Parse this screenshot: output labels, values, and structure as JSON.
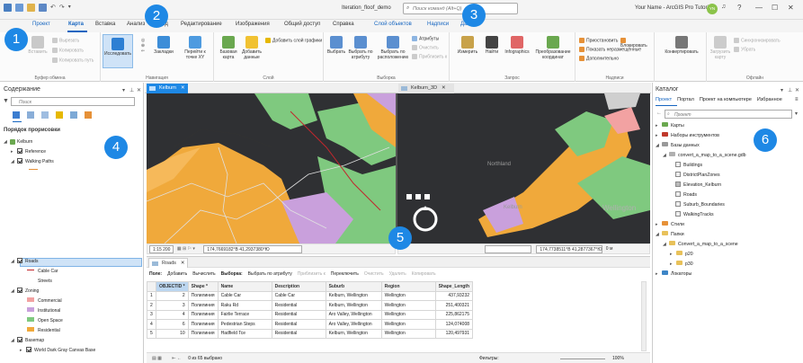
{
  "titlebar": {
    "doc_title": "Iteration_floof_demo",
    "search_placeholder": "Поиск команд (Alt+Q)",
    "user": "Your Name - ArcGIS Pro Tutorials",
    "avatar": "YN",
    "controls": [
      "?",
      "—",
      "☐",
      "✕"
    ]
  },
  "tabs": [
    "Проект",
    "Карта",
    "Вставка",
    "Анализ",
    "Вид",
    "Редактирование",
    "Изображения",
    "Общий доступ",
    "Справка",
    "Слой объектов",
    "Надписи",
    "Данные"
  ],
  "active_tab": "Карта",
  "ribbon": {
    "clipboard": {
      "paste": "Вставить",
      "cut": "Вырезать",
      "copy": "Копировать",
      "copy_path": "Копировать путь",
      "label": "Буфер обмена"
    },
    "navigate": {
      "explore": "Исследовать",
      "bookmarks": "Закладки",
      "goto": "Перейти к точке XY",
      "label": "Навигация"
    },
    "layer": {
      "basemap": "Базовая карта",
      "add_data": "Добавить данные",
      "add_graphics": "Добавить слой графики",
      "label": "Слой"
    },
    "selection": {
      "select": "Выбрать",
      "by_attr": "Выбрать по атрибуту",
      "by_loc": "Выбрать по расположению",
      "attributes": "Атрибуты",
      "clear": "Очистить",
      "zoom_to": "Приблизить к",
      "label": "Выборка"
    },
    "inquiry": {
      "measure": "Измерить",
      "locate": "Найти",
      "infographics": "Infographics",
      "convert": "Преобразование координат",
      "label": "Запрос"
    },
    "labeling": {
      "pause": "Приостановить",
      "lock": "Блокировать",
      "show_unplaced": "Показать неразмещённые",
      "more": "Дополнительно",
      "label": "Надписи"
    },
    "convert": "Конвертировать",
    "offline": {
      "download": "Загрузить карту",
      "sync": "Синхронизировать",
      "remove": "Убрать",
      "label": "Офлайн"
    }
  },
  "contents": {
    "title": "Содержание",
    "search_placeholder": "Поиск",
    "drawing_order": "Порядок прорисовки",
    "map_name": "Kelburn",
    "layers": [
      {
        "name": "Reference"
      },
      {
        "name": "Walking Paths"
      },
      {
        "name": "Roads"
      },
      {
        "name": "Cable Car"
      },
      {
        "name": "Streets"
      },
      {
        "name": "Zoning"
      },
      {
        "name": "Commercial"
      },
      {
        "name": "Institutional"
      },
      {
        "name": "Open Space"
      },
      {
        "name": "Residential"
      },
      {
        "name": "Basemap"
      },
      {
        "name": "World Dark Gray Canvas Base"
      }
    ]
  },
  "views": {
    "tab1": "Kelburn",
    "tab2": "Kelburn_3D",
    "map_labels": [
      "Northland",
      "Kelburn",
      "Wellington"
    ],
    "status1": {
      "scale": "1:15 200",
      "coords": "174,7669182°В 41,2937380°Ю"
    },
    "status2": {
      "coords": "174,7738511°В 41,2877367°Ю",
      "elev": "0 м"
    }
  },
  "table": {
    "tab": "Roads",
    "toolbar": {
      "field": "Поле:",
      "add": "Добавить",
      "calc": "Вычислить",
      "sel": "Выборка:",
      "by_attr": "Выбрать по атрибуту",
      "zoom": "Приблизить к",
      "switch": "Переключить",
      "clear": "Очистить",
      "del": "Удалить",
      "copy": "Копировать"
    },
    "columns": [
      "OBJECTID *",
      "Shape *",
      "Name",
      "Description",
      "Suburb",
      "Region",
      "Shape_Length"
    ],
    "rows": [
      [
        "2",
        "Полилиния",
        "Cable Car",
        "Cable Car",
        "Kelburn, Wellington",
        "Wellington",
        "437,93232"
      ],
      [
        "3",
        "Полилиния",
        "Raku Rd",
        "Residential",
        "Kelburn, Wellington",
        "Wellington",
        "251,400321"
      ],
      [
        "4",
        "Полилиния",
        "Fairlie Terrace",
        "Residential",
        "Aro Valley, Wellington",
        "Wellington",
        "225,862175"
      ],
      [
        "6",
        "Полилиния",
        "Pedestrian Steps",
        "Residential",
        "Aro Valley, Wellington",
        "Wellington",
        "124,074008"
      ],
      [
        "10",
        "Полилиния",
        "Hadfield Tce",
        "Residential",
        "Kelburn, Wellington",
        "Wellington",
        "120,497931"
      ]
    ],
    "footer": {
      "selected": "0 из 65 выбрано",
      "filters": "Фильтры:",
      "zoom": "100%"
    }
  },
  "catalog": {
    "title": "Каталог",
    "tabs": [
      "Проект",
      "Портал",
      "Проект на компьютере",
      "Избранное"
    ],
    "search_placeholder": "Проект",
    "items": [
      {
        "label": "Карты"
      },
      {
        "label": "Наборы инструментов"
      },
      {
        "label": "Базы данных"
      },
      {
        "label": "convert_a_map_to_a_scene.gdb"
      },
      {
        "label": "Buildings"
      },
      {
        "label": "DistrictPlanZones"
      },
      {
        "label": "Elevation_Kelburn"
      },
      {
        "label": "Roads"
      },
      {
        "label": "Suburb_Boundaries"
      },
      {
        "label": "WalkingTracks"
      },
      {
        "label": "Стили"
      },
      {
        "label": "Папки"
      },
      {
        "label": "Convert_a_map_to_a_scene"
      },
      {
        "label": "p20"
      },
      {
        "label": "p30"
      },
      {
        "label": "Локаторы"
      }
    ]
  },
  "callouts": [
    "1",
    "2",
    "3",
    "4",
    "5",
    "6"
  ],
  "colors": {
    "accent": "#1565c0",
    "badge": "#1e88e5",
    "residential": "#f0a93b",
    "open_space": "#7fc97f",
    "institutional": "#c9a0dc",
    "map_bg": "#2f3033"
  }
}
